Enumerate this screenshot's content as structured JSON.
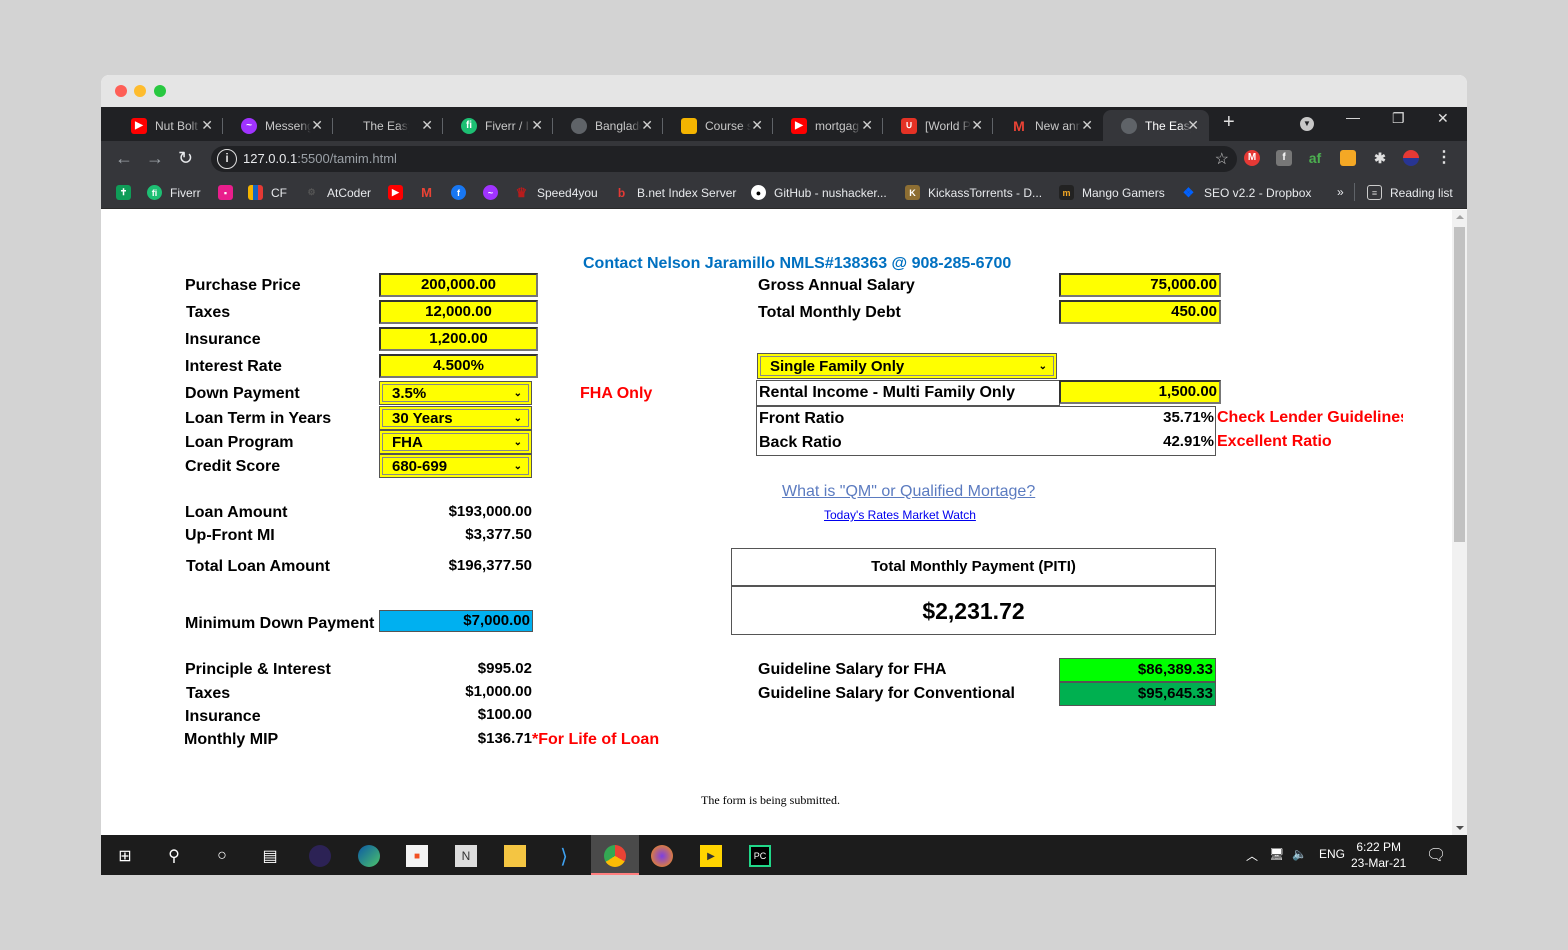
{
  "browser": {
    "tabs": [
      {
        "label": "Nut Bolt",
        "icon": "youtube-icon",
        "color": "#ff0000"
      },
      {
        "label": "Messeng",
        "icon": "messenger-icon",
        "color": "#a033ff"
      },
      {
        "label": "The Easy",
        "icon": "none",
        "color": ""
      },
      {
        "label": "Fiverr / I",
        "icon": "fiverr-icon",
        "color": "#1dbf73"
      },
      {
        "label": "Banglade",
        "icon": "globe-icon",
        "color": "#5f6368"
      },
      {
        "label": "Course s",
        "icon": "classroom-icon",
        "color": "#f4b400"
      },
      {
        "label": "mortgag",
        "icon": "youtube-icon",
        "color": "#ff0000"
      },
      {
        "label": "[World P",
        "icon": "aliexpress-icon",
        "color": "#e43225"
      },
      {
        "label": "New ann",
        "icon": "gmail-icon",
        "color": "#ea4335"
      },
      {
        "label": "The Easy",
        "icon": "globe-icon",
        "color": "#5f6368"
      }
    ],
    "active_tab_index": 9,
    "url_host": "127.0.0.1",
    "url_rest": ":5500/tamim.html",
    "bookmarks": [
      {
        "label": "",
        "icon": "sheets-icon",
        "color": "#0f9d58"
      },
      {
        "label": "Fiverr",
        "icon": "fiverr-icon",
        "color": "#1dbf73"
      },
      {
        "label": "",
        "icon": "contact-icon",
        "color": "#e91e8c"
      },
      {
        "label": "CF",
        "icon": "codeforces-icon",
        "color": "#f4b400"
      },
      {
        "label": "AtCoder",
        "icon": "atcoder-icon",
        "color": "#444"
      },
      {
        "label": "",
        "icon": "youtube-icon",
        "color": "#ff0000"
      },
      {
        "label": "",
        "icon": "gmail-icon",
        "color": "#ea4335"
      },
      {
        "label": "",
        "icon": "facebook-icon",
        "color": "#1877f2"
      },
      {
        "label": "",
        "icon": "messenger-icon",
        "color": "#a033ff"
      },
      {
        "label": "Speed4you",
        "icon": "crown-icon",
        "color": "#b71c1c"
      },
      {
        "label": "B.net Index Server",
        "icon": "bnet-icon",
        "color": "#e53935"
      },
      {
        "label": "GitHub - nushacker...",
        "icon": "github-icon",
        "color": "#fff"
      },
      {
        "label": "KickassTorrents - D...",
        "icon": "kickass-icon",
        "color": "#8d6e33"
      },
      {
        "label": "Mango Gamers",
        "icon": "mango-icon",
        "color": "#333"
      },
      {
        "label": "SEO v2.2 - Dropbox",
        "icon": "dropbox-icon",
        "color": "#0061ff"
      }
    ],
    "more_bookmarks": "»",
    "reading_list": "Reading list"
  },
  "page": {
    "contact": "Contact Nelson Jaramillo NMLS#138363 @ 908-285-6700",
    "inputs": {
      "purchase_price": {
        "label": "Purchase Price",
        "value": "200,000.00"
      },
      "taxes": {
        "label": "Taxes",
        "value": "12,000.00"
      },
      "insurance": {
        "label": "Insurance",
        "value": "1,200.00"
      },
      "interest_rate": {
        "label": "Interest Rate",
        "value": "4.500%"
      },
      "down_payment": {
        "label": "Down Payment",
        "value": "3.5%"
      },
      "loan_term": {
        "label": "Loan Term in Years",
        "value": "30 Years"
      },
      "loan_program": {
        "label": "Loan Program",
        "value": "FHA"
      },
      "credit_score": {
        "label": "Credit Score",
        "value": "680-699"
      },
      "gross_salary": {
        "label": "Gross Annual Salary",
        "value": "75,000.00"
      },
      "monthly_debt": {
        "label": "Total Monthly Debt",
        "value": "450.00"
      },
      "property_type": {
        "value": "Single Family Only"
      },
      "rental_income": {
        "label": "Rental Income - Multi Family Only",
        "value": "1,500.00"
      }
    },
    "fha_only_note": "FHA Only",
    "ratios": {
      "front": {
        "label": "Front Ratio",
        "value": "35.71%",
        "note": "Check Lender Guidelines"
      },
      "back": {
        "label": "Back Ratio",
        "value": "42.91%",
        "note": "Excellent Ratio"
      }
    },
    "results": {
      "loan_amount": {
        "label": "Loan Amount",
        "value": "$193,000.00"
      },
      "upfront_mi": {
        "label": "Up-Front MI",
        "value": "$3,377.50"
      },
      "total_loan": {
        "label": "Total Loan Amount",
        "value": "$196,377.50"
      },
      "min_down": {
        "label": "Minimum Down Payment",
        "value": "$7,000.00"
      },
      "pi": {
        "label": "Principle & Interest",
        "value": "$995.02"
      },
      "taxes": {
        "label": "Taxes",
        "value": "$1,000.00"
      },
      "insurance": {
        "label": "Insurance",
        "value": "$100.00"
      },
      "mip": {
        "label": "Monthly MIP",
        "value": "$136.71",
        "note": "*For Life of Loan"
      }
    },
    "links": {
      "qm": "What is \"QM\" or Qualified Mortage?",
      "rates": "Today's Rates Market Watch"
    },
    "piti": {
      "label": "Total Monthly Payment (PITI)",
      "value": "$2,231.72"
    },
    "guideline": {
      "fha": {
        "label": "Guideline Salary for FHA",
        "value": "$86,389.33",
        "color": "#00ff00"
      },
      "conv": {
        "label": "Guideline Salary for Conventional",
        "value": "$95,645.33",
        "color": "#00b050"
      }
    },
    "status": "The form is being submitted."
  },
  "taskbar": {
    "language": "ENG",
    "time": "6:22 PM",
    "date": "23-Mar-21"
  }
}
